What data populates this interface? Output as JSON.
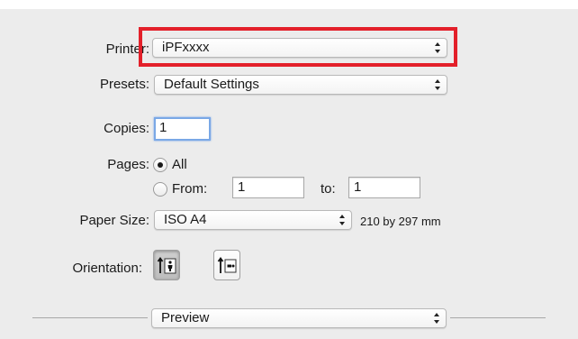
{
  "printer": {
    "label": "Printer:",
    "value": "iPFxxxx"
  },
  "presets": {
    "label": "Presets:",
    "value": "Default Settings"
  },
  "copies": {
    "label": "Copies:",
    "value": "1"
  },
  "pages": {
    "label": "Pages:",
    "all_label": "All",
    "from_label": "From:",
    "from_value": "1",
    "to_label": "to:",
    "to_value": "1",
    "selected": "All"
  },
  "paper_size": {
    "label": "Paper Size:",
    "value": "ISO A4",
    "dimensions": "210 by 297 mm"
  },
  "orientation": {
    "label": "Orientation:",
    "options": [
      {
        "icon": "portrait-orientation-icon",
        "selected": true
      },
      {
        "icon": "landscape-orientation-icon",
        "selected": false
      }
    ]
  },
  "section_menu": {
    "value": "Preview"
  },
  "colors": {
    "highlight": "#e3202a",
    "focus": "#7aa8e6",
    "panel_bg": "#ececec"
  }
}
